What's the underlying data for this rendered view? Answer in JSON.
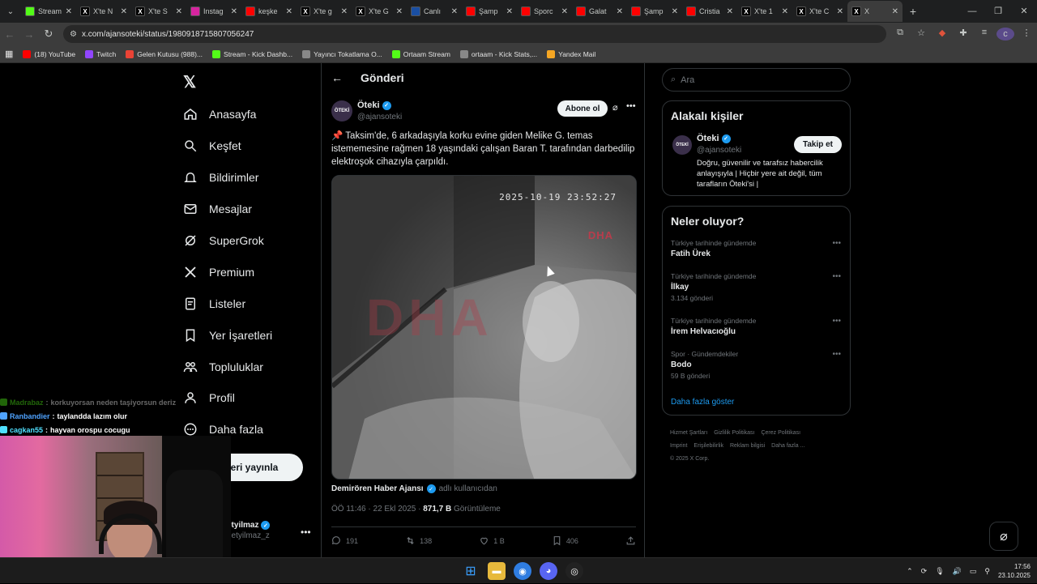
{
  "browser": {
    "tabs": [
      {
        "label": "Stream",
        "icon": "kick-icon",
        "color": "#53fc18",
        "active": false
      },
      {
        "label": "X'te N",
        "icon": "x-icon",
        "color": "#000000",
        "active": false
      },
      {
        "label": "X'te S",
        "icon": "x-icon",
        "color": "#000000",
        "active": false
      },
      {
        "label": "Instag",
        "icon": "instagram-icon",
        "color": "#d6249f",
        "active": false
      },
      {
        "label": "keşke",
        "icon": "youtube-icon",
        "color": "#ff0000",
        "active": false
      },
      {
        "label": "X'te g",
        "icon": "x-icon",
        "color": "#000000",
        "active": false
      },
      {
        "label": "X'te G",
        "icon": "x-icon",
        "color": "#000000",
        "active": false
      },
      {
        "label": "Canlı",
        "icon": "m-icon",
        "color": "#1a4fa3",
        "active": false
      },
      {
        "label": "Şamp",
        "icon": "youtube-icon",
        "color": "#ff0000",
        "active": false
      },
      {
        "label": "Sporc",
        "icon": "youtube-icon",
        "color": "#ff0000",
        "active": false
      },
      {
        "label": "Galat",
        "icon": "youtube-icon",
        "color": "#ff0000",
        "active": false
      },
      {
        "label": "Şamp",
        "icon": "youtube-icon",
        "color": "#ff0000",
        "active": false
      },
      {
        "label": "Cristia",
        "icon": "youtube-icon",
        "color": "#ff0000",
        "active": false
      },
      {
        "label": "X'te 1",
        "icon": "x-icon",
        "color": "#000000",
        "active": false
      },
      {
        "label": "X'te C",
        "icon": "x-icon",
        "color": "#000000",
        "active": false
      },
      {
        "label": "X",
        "icon": "x-icon",
        "color": "#000000",
        "active": true
      }
    ],
    "url": "x.com/ajansoteki/status/1980918715807056247",
    "bookmarks": [
      {
        "label": "(18) YouTube",
        "icon": "youtube-icon",
        "color": "#ff0000"
      },
      {
        "label": "Twitch",
        "icon": "twitch-icon",
        "color": "#9146ff"
      },
      {
        "label": "Gelen Kutusu (988)...",
        "icon": "gmail-icon",
        "color": "#ea4335"
      },
      {
        "label": "Stream - Kick Dashb...",
        "icon": "kick-icon",
        "color": "#53fc18"
      },
      {
        "label": "Yayıncı Tokatlama O...",
        "icon": "globe-icon",
        "color": "#888888"
      },
      {
        "label": "Ortaam Stream",
        "icon": "kick-icon",
        "color": "#53fc18"
      },
      {
        "label": "ortaam - Kick Stats,...",
        "icon": "globe-icon",
        "color": "#888888"
      },
      {
        "label": "Yandex Mail",
        "icon": "mail-icon",
        "color": "#f5a623"
      }
    ]
  },
  "nav": {
    "items": [
      {
        "label": "Anasayfa",
        "icon": "home-icon"
      },
      {
        "label": "Keşfet",
        "icon": "search-icon"
      },
      {
        "label": "Bildirimler",
        "icon": "bell-icon"
      },
      {
        "label": "Mesajlar",
        "icon": "mail-icon"
      },
      {
        "label": "SuperGrok",
        "icon": "grok-icon"
      },
      {
        "label": "Premium",
        "icon": "x-icon"
      },
      {
        "label": "Listeler",
        "icon": "list-icon"
      },
      {
        "label": "Yer İşaretleri",
        "icon": "bookmark-icon"
      },
      {
        "label": "Topluluklar",
        "icon": "people-icon"
      },
      {
        "label": "Profil",
        "icon": "person-icon"
      },
      {
        "label": "Daha fazla",
        "icon": "more-circle-icon"
      }
    ],
    "post_button": "eri yayınla",
    "account_name": "etyilmaz",
    "account_handle": "netyilmaz_z"
  },
  "post": {
    "header": "Gönderi",
    "author": "Öteki",
    "handle": "@ajansoteki",
    "avatar_text": "ÖTEKİ",
    "subscribe": "Abone ol",
    "text": "📌 Taksim'de, 6 arkadaşıyla korku evine giden Melike G. temas istememesine rağmen 18 yaşındaki çalışan Baran T. tarafından darbedilip elektroşok cihazıyla çarpıldı.",
    "video_timestamp": "2025-10-19 23:52:27",
    "video_logo": "DHA",
    "source_name": "Demirören Haber Ajansı",
    "source_via": "adlı kullanıcıdan",
    "time": "ÖÖ 11:46 · 22 Ekl 2025 ·",
    "views": "871,7 B",
    "views_label": "Görüntüleme",
    "replies": "191",
    "reposts": "138",
    "likes": "1 B",
    "bookmarks": "406"
  },
  "right": {
    "search_placeholder": "Ara",
    "related_title": "Alakalı kişiler",
    "related_name": "Öteki",
    "related_handle": "@ajansoteki",
    "follow": "Takip et",
    "related_bio": "Doğru, güvenilir ve tarafsız habercilik anlayışıyla | Hiçbir yere ait değil, tüm tarafların Öteki'si |",
    "trends_title": "Neler oluyor?",
    "trends": [
      {
        "category": "Türkiye tarihinde gündemde",
        "name": "Fatih Ürek",
        "posts": ""
      },
      {
        "category": "Türkiye tarihinde gündemde",
        "name": "İlkay",
        "posts": "3.134 gönderi"
      },
      {
        "category": "Türkiye tarihinde gündemde",
        "name": "İrem Helvacıoğlu",
        "posts": ""
      },
      {
        "category": "Spor · Gündemdekiler",
        "name": "Bodo",
        "posts": "59 B gönderi"
      }
    ],
    "show_more": "Daha fazla göster",
    "footer": [
      "Hizmet Şartları",
      "Gizlilik Politikası",
      "Çerez Politikası",
      "Imprint",
      "Erişilebilirlik",
      "Reklam bilgisi",
      "Daha fazla ...",
      "© 2025 X Corp."
    ]
  },
  "chat": [
    {
      "user": "Madrabaz",
      "msg": "korkuyorsan neden taşiyorsun deriz",
      "color": "#53fc18",
      "faded": true
    },
    {
      "user": "Ranbandier",
      "msg": "taylandda lazım olur",
      "color": "#4fa3ff",
      "faded": false
    },
    {
      "user": "cagkan55",
      "msg": "hayvan orospu cocugu",
      "color": "#4fe0ff",
      "faded": false
    }
  ],
  "taskbar": {
    "time": "17:56",
    "date": "23.10.2025"
  }
}
